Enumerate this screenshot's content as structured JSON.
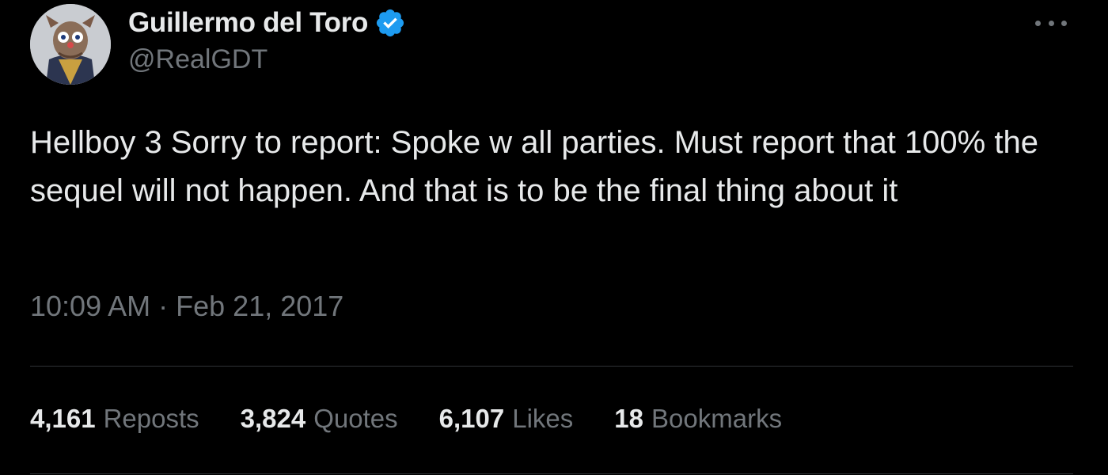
{
  "author": {
    "display_name": "Guillermo del Toro",
    "handle": "@RealGDT",
    "verified": true
  },
  "tweet": {
    "text": "Hellboy 3 Sorry to report: Spoke w all parties. Must report that 100% the sequel will not happen. And that is to be the final thing about it",
    "time": "10:09 AM",
    "separator": "·",
    "date": "Feb 21, 2017"
  },
  "stats": [
    {
      "count": "4,161",
      "label": "Reposts"
    },
    {
      "count": "3,824",
      "label": "Quotes"
    },
    {
      "count": "6,107",
      "label": "Likes"
    },
    {
      "count": "18",
      "label": "Bookmarks"
    }
  ],
  "icons": {
    "verified": "verified-badge-icon",
    "more": "more-dots-icon"
  },
  "colors": {
    "background": "#000000",
    "text_primary": "#e7e9ea",
    "text_secondary": "#71767b",
    "divider": "#2f3336",
    "verified_blue": "#1d9bf0"
  }
}
